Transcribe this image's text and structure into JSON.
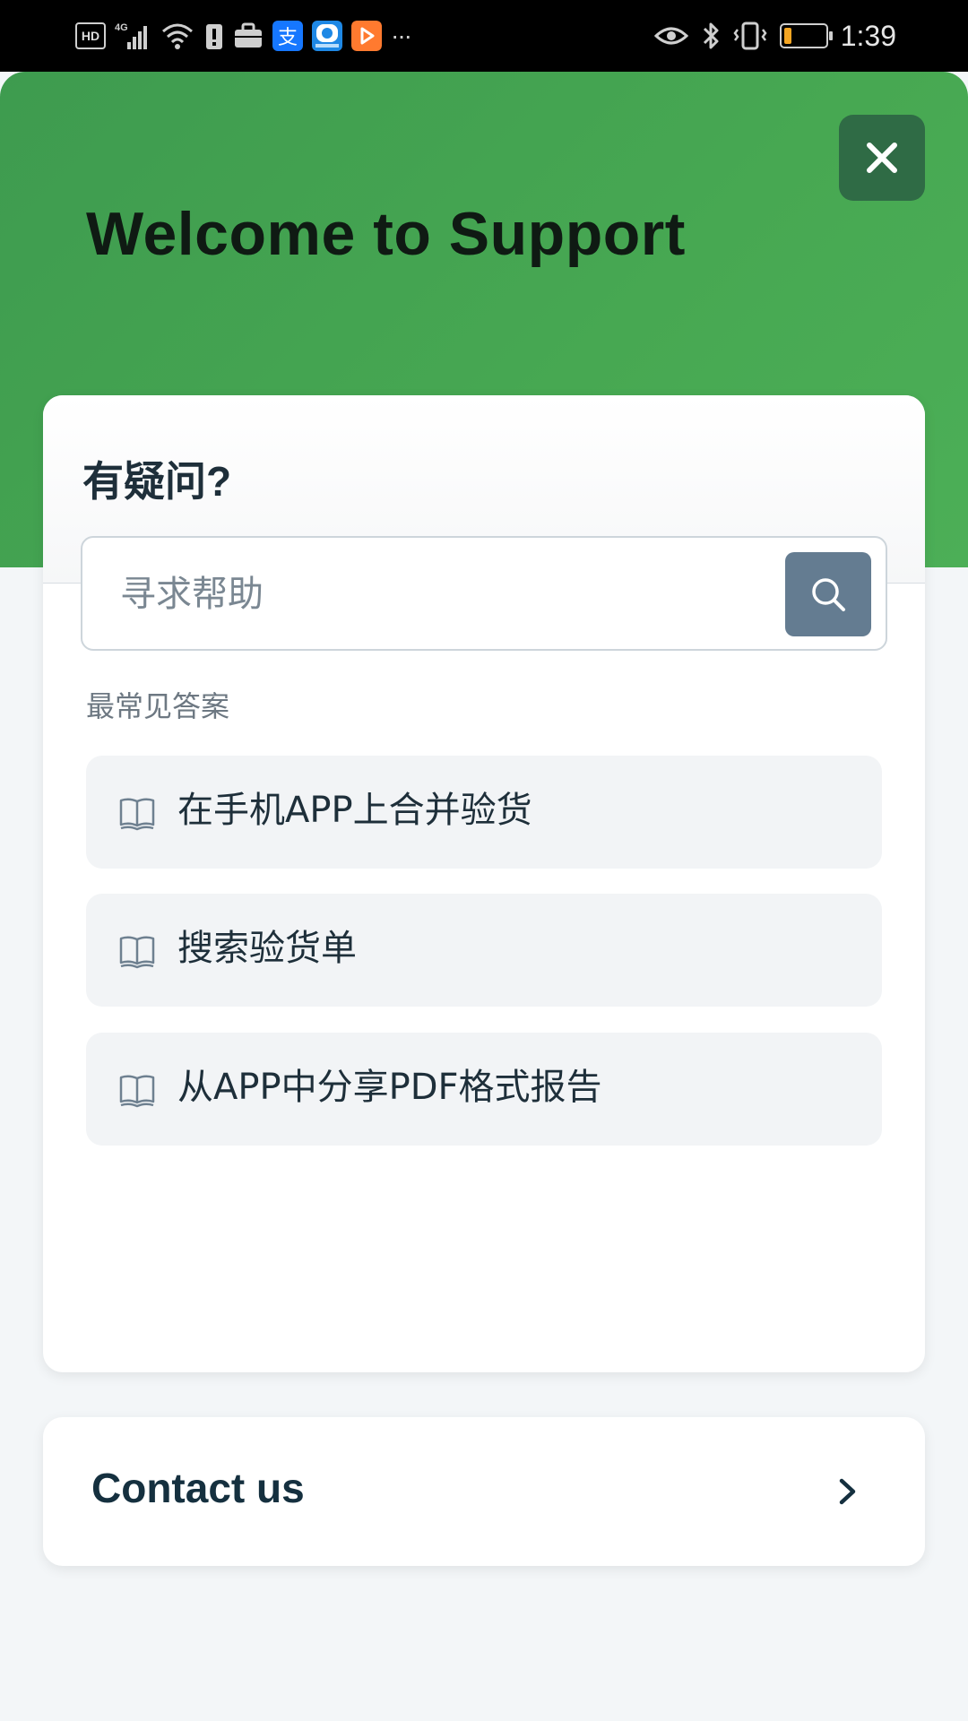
{
  "status_bar": {
    "left_icons": [
      "hd-icon",
      "signal-4g-icon",
      "wifi-icon",
      "alert-icon",
      "briefcase-icon",
      "alipay-icon",
      "app-icon",
      "video-icon",
      "more-icon"
    ],
    "hd_text": "HD",
    "network_text": "4G",
    "more_text": "···",
    "time": "1:39",
    "battery_level": 0.2,
    "colors": {
      "alipay": "#1677ff",
      "app_blue": "#1e88e5",
      "video_orange": "#ff7a2f",
      "battery_fill": "#f5a623"
    }
  },
  "header": {
    "title": "Welcome to Support",
    "close_icon": "close-icon",
    "bg_color": "#47a852",
    "close_bg_color": "#2f6b45"
  },
  "help_card": {
    "question_title": "有疑问?",
    "search": {
      "placeholder": "寻求帮助",
      "value": "",
      "button_icon": "search-icon"
    },
    "faq_heading": "最常见答案",
    "faq_items": [
      {
        "icon": "book-icon",
        "label": "在手机APP上合并验货"
      },
      {
        "icon": "book-icon",
        "label": "搜索验货单"
      },
      {
        "icon": "book-icon",
        "label": "从APP中分享PDF格式报告"
      }
    ]
  },
  "contact": {
    "label": "Contact us",
    "icon": "chevron-right-icon"
  }
}
